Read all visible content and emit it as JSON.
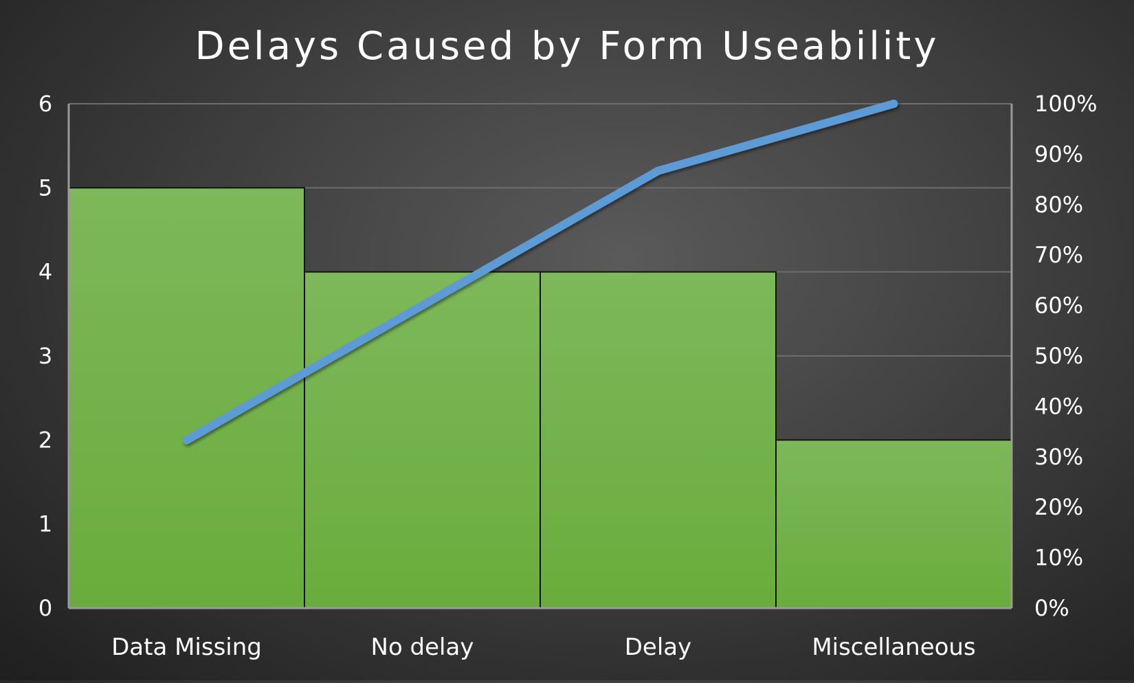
{
  "chart_data": {
    "type": "bar",
    "title": "Delays Caused by Form Useability",
    "categories": [
      "Data Missing",
      "No delay",
      "Delay",
      "Miscellaneous"
    ],
    "series": [
      {
        "type": "bar",
        "values": [
          5,
          4,
          4,
          2
        ]
      },
      {
        "type": "line",
        "axis": "secondary",
        "values": [
          33.3,
          60.0,
          86.7,
          100.0
        ]
      }
    ],
    "ylim": [
      0,
      6
    ],
    "y_ticks": [
      "0",
      "1",
      "2",
      "3",
      "4",
      "5",
      "6"
    ],
    "y2lim": [
      0,
      100
    ],
    "y2_ticks": [
      "0%",
      "10%",
      "20%",
      "30%",
      "40%",
      "50%",
      "60%",
      "70%",
      "80%",
      "90%",
      "100%"
    ],
    "grid": true,
    "legend": "none",
    "colors": {
      "bar": "#6aac3c",
      "bar_top": "#7db85a",
      "bar_outline": "#111111",
      "line": "#5b9bd5",
      "gridline": "#6e6e6e",
      "axis": "#9a9a9a",
      "text": "#ffffff"
    }
  }
}
